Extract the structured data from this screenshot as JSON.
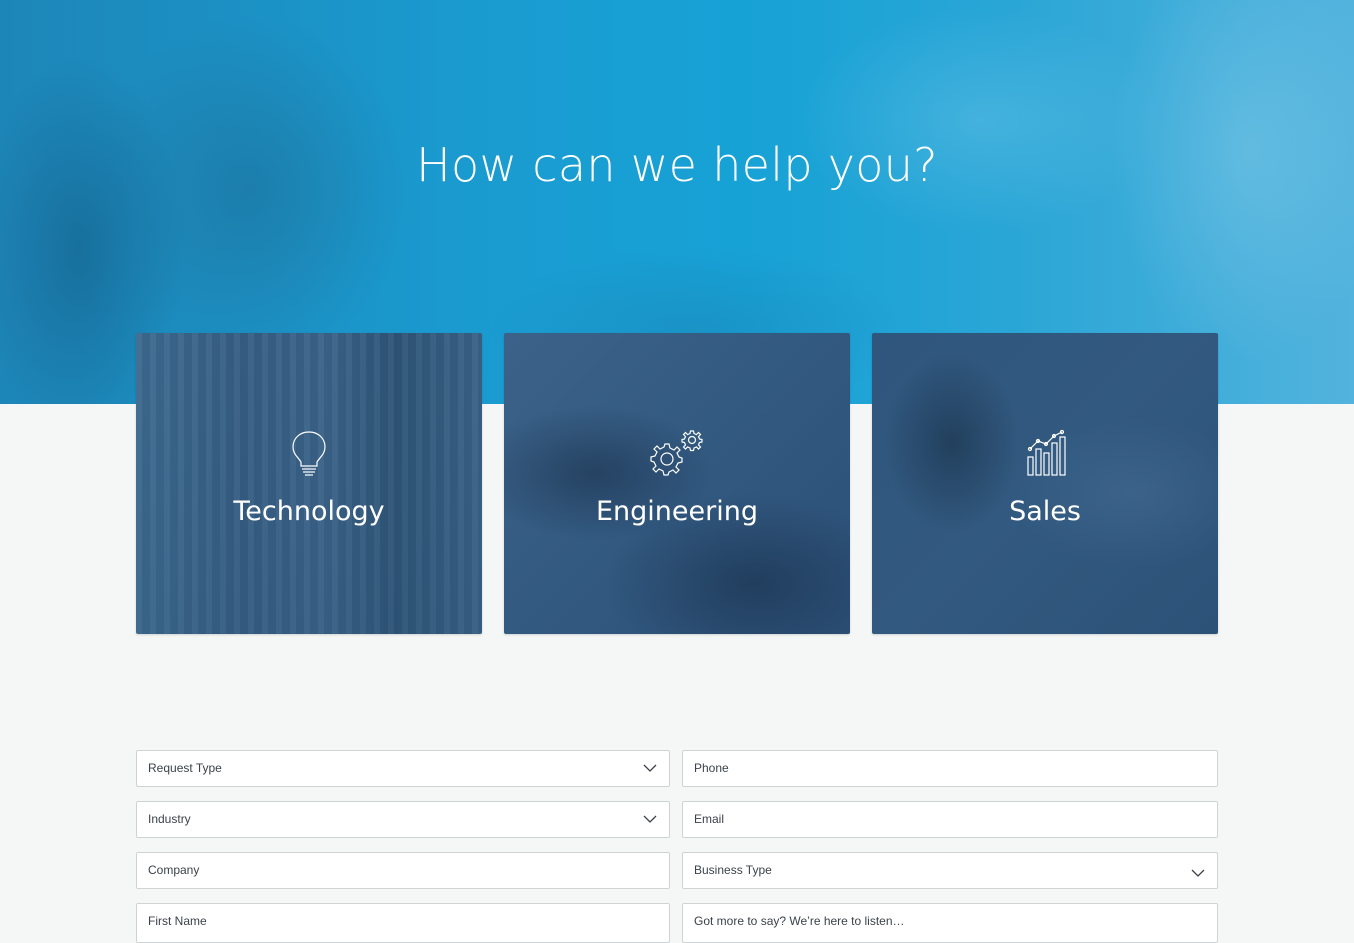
{
  "hero": {
    "title": "How can we help you?"
  },
  "cards": [
    {
      "label": "Technology",
      "icon": "lightbulb-icon"
    },
    {
      "label": "Engineering",
      "icon": "gears-icon"
    },
    {
      "label": "Sales",
      "icon": "bar-chart-icon"
    }
  ],
  "form": {
    "request_type": "Request Type",
    "phone": "Phone",
    "industry": "Industry",
    "email": "Email",
    "company": "Company",
    "business_type": "Business Type",
    "first_name": "First Name",
    "message": "Got more to say?  We’re here to listen…"
  },
  "colors": {
    "hero_blue": "#17a2d6",
    "card_navy": "#335a81",
    "page_bg": "#f5f7f6"
  }
}
